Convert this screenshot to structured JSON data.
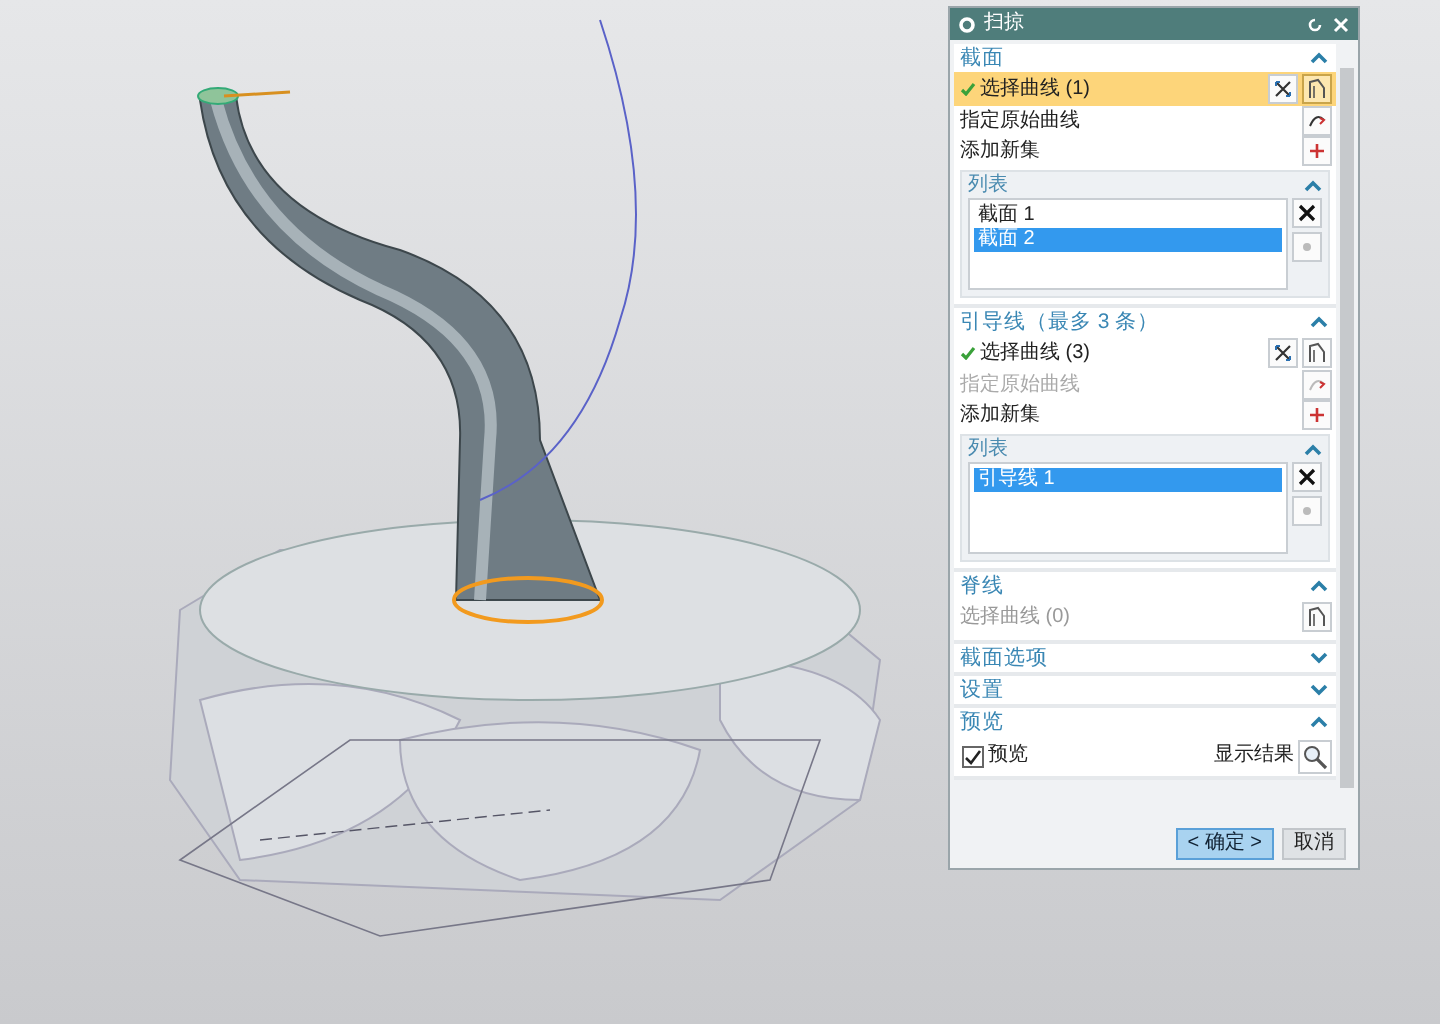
{
  "dialog": {
    "title": "扫掠"
  },
  "sections": [
    {
      "kind": "curve_set",
      "title": "截面",
      "expanded": true,
      "select": {
        "label": "选择曲线 (1)",
        "done": true,
        "active": true
      },
      "rows": [
        {
          "label": "指定原始曲线",
          "disabled": false
        },
        {
          "label": "添加新集",
          "disabled": false
        }
      ],
      "list": {
        "title": "列表",
        "items": [
          {
            "label": "截面 1",
            "selected": false
          },
          {
            "label": "截面 2",
            "selected": true
          }
        ]
      }
    },
    {
      "kind": "curve_set",
      "title": "引导线（最多 3 条）",
      "expanded": true,
      "select": {
        "label": "选择曲线 (3)",
        "done": true,
        "active": false
      },
      "rows": [
        {
          "label": "指定原始曲线",
          "disabled": true
        },
        {
          "label": "添加新集",
          "disabled": false
        }
      ],
      "list": {
        "title": "列表",
        "items": [
          {
            "label": "引导线 1",
            "selected": true
          }
        ]
      }
    },
    {
      "kind": "spine",
      "title": "脊线",
      "expanded": true,
      "select": {
        "label": "选择曲线 (0)",
        "done": false,
        "active": false
      }
    },
    {
      "kind": "plain",
      "title": "截面选项",
      "expanded": false
    },
    {
      "kind": "plain",
      "title": "设置",
      "expanded": false
    },
    {
      "kind": "preview",
      "title": "预览",
      "expanded": true,
      "checkbox": {
        "label": "预览",
        "checked": true
      },
      "result_label": "显示结果"
    }
  ],
  "buttons": [
    {
      "label": "< 确定 >",
      "default": true
    },
    {
      "label": "取消",
      "default": false
    }
  ]
}
